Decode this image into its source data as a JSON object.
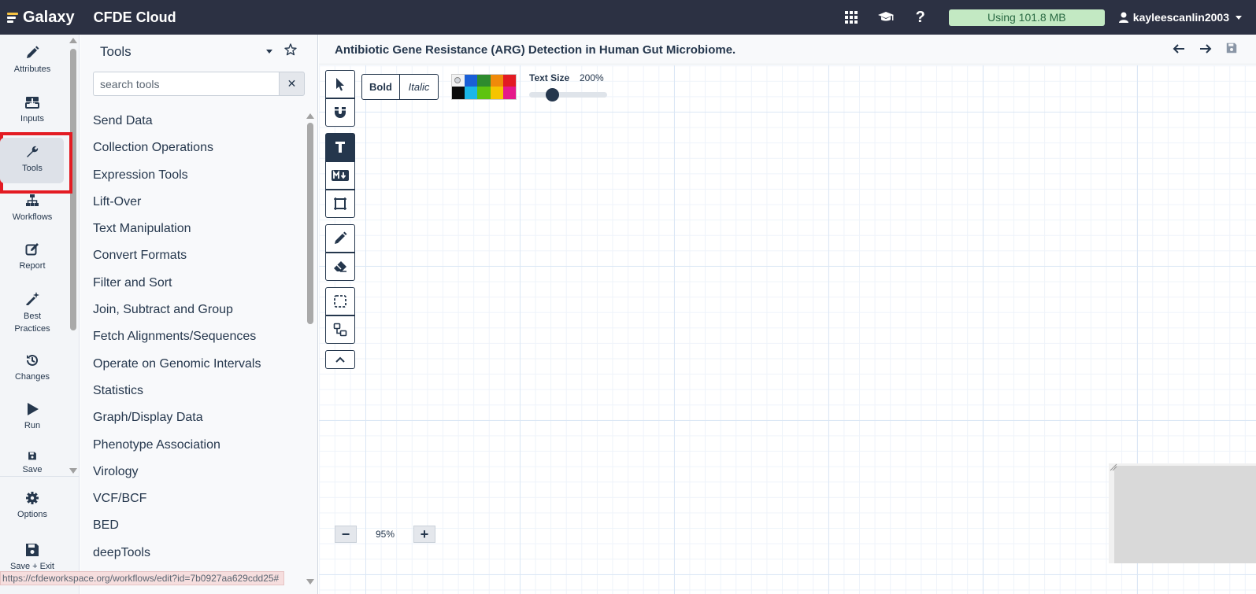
{
  "topbar": {
    "brand": "Galaxy",
    "app_title": "CFDE Cloud",
    "usage": "Using 101.8 MB",
    "username": "kayleescanlin2003",
    "icons": [
      "grid-icon",
      "graduation-cap-icon",
      "question-icon",
      "user-icon"
    ],
    "usage_color": "#c3e9c3"
  },
  "activity_bar": {
    "items": [
      {
        "label": "Attributes",
        "icon": "pencil-icon"
      },
      {
        "label": "Inputs",
        "icon": "inputs-icon"
      },
      {
        "label": "Tools",
        "icon": "wrench-icon",
        "active": true
      },
      {
        "label": "Workflows",
        "icon": "sitemap-icon"
      },
      {
        "label": "Report",
        "icon": "edit-icon"
      },
      {
        "label": "Best Practices",
        "icon": "magic-icon"
      },
      {
        "label": "Changes",
        "icon": "history-icon"
      },
      {
        "label": "Run",
        "icon": "play-icon"
      },
      {
        "label": "Save",
        "icon": "save-icon"
      },
      {
        "label": "Options",
        "icon": "gear-icon"
      },
      {
        "label": "Save + Exit",
        "icon": "save-icon"
      }
    ]
  },
  "tool_panel": {
    "title": "Tools",
    "search_placeholder": "search tools",
    "clear_label": "✕",
    "sections": [
      "Send Data",
      "Collection Operations",
      "Expression Tools",
      "Lift-Over",
      "Text Manipulation",
      "Convert Formats",
      "Filter and Sort",
      "Join, Subtract and Group",
      "Fetch Alignments/Sequences",
      "Operate on Genomic Intervals",
      "Statistics",
      "Graph/Display Data",
      "Phenotype Association",
      "Virology",
      "VCF/BCF",
      "BED",
      "deepTools"
    ]
  },
  "editor": {
    "title": "Antibiotic Gene Resistance (ARG) Detection in Human Gut Microbiome.",
    "format": {
      "bold_label": "Bold",
      "italic_label": "Italic",
      "text_size_label": "Text Size",
      "text_size_value": "200%",
      "text_size_level": 0.25,
      "palette": [
        "#f2f2f2",
        "#1a5fd6",
        "#2e8b2e",
        "#f08a0a",
        "#e31b23",
        "#0a0a0a",
        "#1ab6e8",
        "#5ec30f",
        "#f6c400",
        "#e5198a"
      ]
    },
    "zoom": {
      "minus": "−",
      "value": "95%",
      "plus": "+"
    }
  },
  "status_url": "https://cfdeworkspace.org/workflows/edit?id=7b0927aa629cdd25#"
}
